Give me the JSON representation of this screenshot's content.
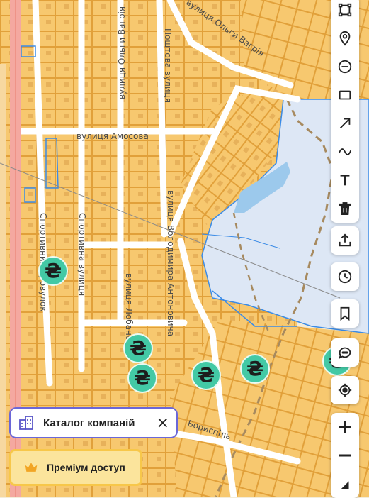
{
  "map": {
    "streets": [
      {
        "label": "вулиця Амосова"
      },
      {
        "label": "вулиця Ольги Вагрія"
      },
      {
        "label": "Поштова вулиця"
      },
      {
        "label": "вулиця Ольги Вагрія"
      },
      {
        "label": "Спортивний провулок"
      },
      {
        "label": "Спортивна вулиця"
      },
      {
        "label": "вулиця Лобанова"
      },
      {
        "label": "вулиця Володимира Антоновича"
      },
      {
        "label": "Бориспіль"
      }
    ],
    "marker_symbol": "₴",
    "colors": {
      "marker": "#43c9a5",
      "parcel": "#f7c86f",
      "parcel_stroke": "#e5a033",
      "water": "#dde7f5",
      "water_body": "#9cc9ec",
      "highway": "#f4a8a0",
      "accent": "#6b67d8",
      "premium": "#fbe49c"
    }
  },
  "toolbar": {
    "draw_tools": [
      "polygon-icon",
      "pin-icon",
      "circle-icon",
      "rectangle-icon",
      "arrow-icon",
      "freehand-icon",
      "text-icon",
      "trash-icon"
    ],
    "share": "upload-icon",
    "history": "clock-icon",
    "bookmark": "bookmark-icon",
    "chat": "chat-icon",
    "locate": "locate-icon",
    "zoom_in": "+",
    "zoom_out": "−",
    "compass": "compass-icon"
  },
  "catalog": {
    "label": "Каталог компаній",
    "close": "×"
  },
  "premium": {
    "label": "Преміум доступ"
  }
}
